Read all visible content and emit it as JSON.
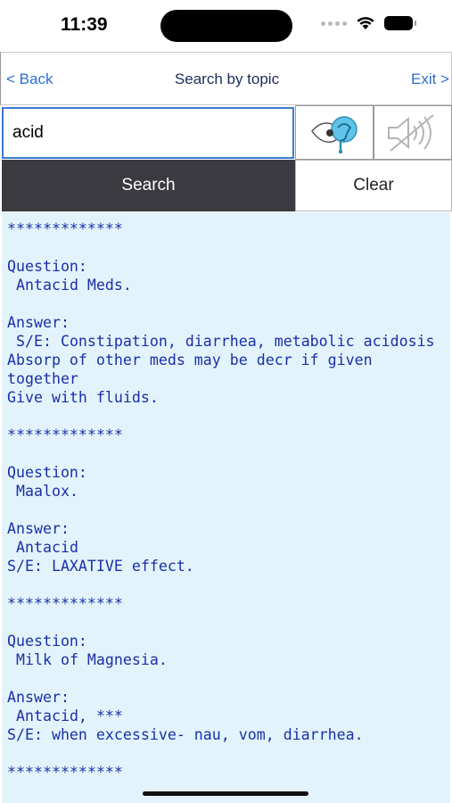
{
  "status_bar": {
    "time": "11:39"
  },
  "nav": {
    "back_label": "< Back",
    "title": "Search by topic",
    "exit_label": "Exit >"
  },
  "search": {
    "value": "acid",
    "listen_icon": "ear-listen-icon",
    "mute_icon": "speaker-muted-icon"
  },
  "actions": {
    "search_label": "Search",
    "clear_label": "Clear"
  },
  "results": {
    "text": "*************\n\nQuestion:\n Antacid Meds.\n\nAnswer:\n S/E: Constipation, diarrhea, metabolic acidosis\nAbsorp of other meds may be decr if given together\nGive with fluids.\n\n*************\n\nQuestion:\n Maalox.\n\nAnswer:\n Antacid\nS/E: LAXATIVE effect.\n\n*************\n\nQuestion:\n Milk of Magnesia.\n\nAnswer:\n Antacid, ***\nS/E: when excessive- nau, vom, diarrhea.\n\n*************"
  },
  "colors": {
    "link": "#2a6fd6",
    "result_text": "#1a2fa8",
    "result_bg": "#e3f3fb",
    "search_button_bg": "#3a3a40"
  }
}
